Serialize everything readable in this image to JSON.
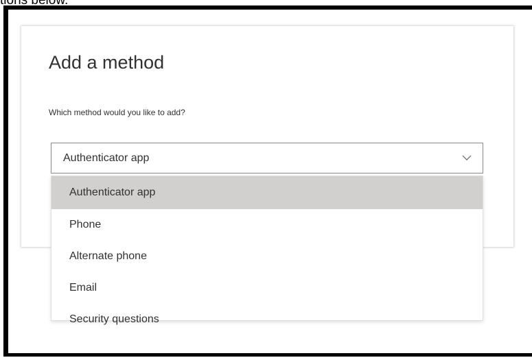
{
  "header_fragment": "tions below.",
  "dialog": {
    "title": "Add a method",
    "prompt": "Which method would you like to add?"
  },
  "select": {
    "value": "Authenticator app",
    "chevron_icon": "chevron-down-icon"
  },
  "dropdown": {
    "options": [
      {
        "label": "Authenticator app",
        "selected": true
      },
      {
        "label": "Phone",
        "selected": false
      },
      {
        "label": "Alternate phone",
        "selected": false
      },
      {
        "label": "Email",
        "selected": false
      },
      {
        "label": "Security questions",
        "selected": false
      }
    ]
  },
  "colors": {
    "frame_border": "#000000",
    "selected_option_bg": "#d2d0ce",
    "text": "#323130",
    "select_border": "#8a8886"
  }
}
